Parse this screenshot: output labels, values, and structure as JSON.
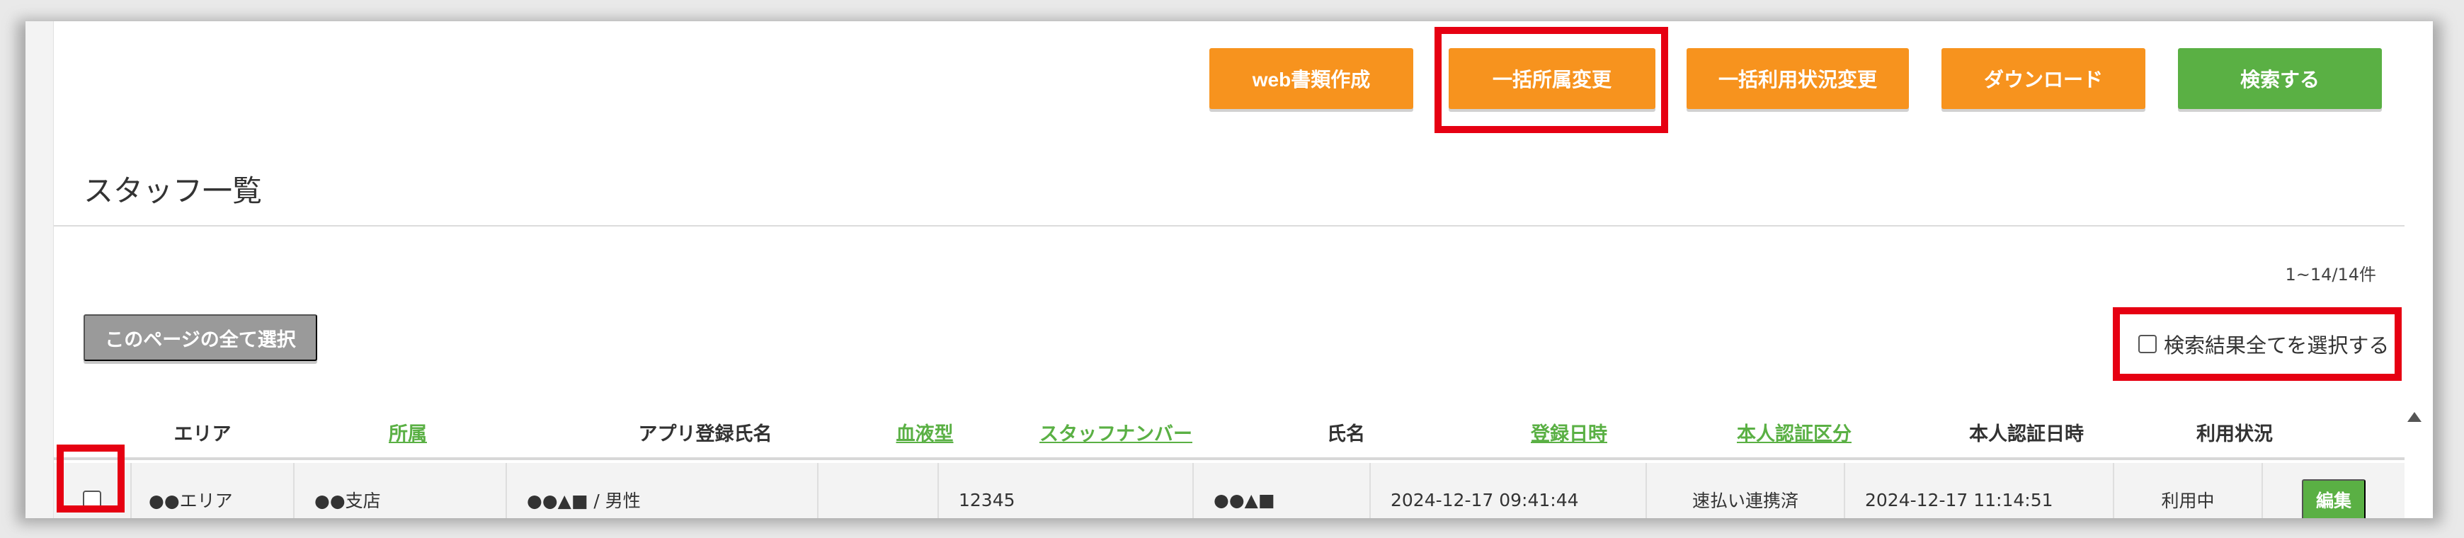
{
  "toolbar": {
    "web_docs": "web書類作成",
    "bulk_affiliation": "一括所属変更",
    "bulk_usage": "一括利用状況変更",
    "download": "ダウンロード",
    "search": "検索する"
  },
  "page_title": "スタッフ一覧",
  "result_count": "1~14/14件",
  "select_page_label": "このページの全て選択",
  "select_all_results_label": "検索結果全てを選択する",
  "table": {
    "headers": [
      "エリア",
      "所属",
      "アプリ登録氏名",
      "血液型",
      "スタッフナンバー",
      "氏名",
      "登録日時",
      "本人認証区分",
      "本人認証日時",
      "利用状況"
    ],
    "rows": [
      {
        "area": "●●エリア",
        "affiliation": "●●支店",
        "app_name": "●●▲■ / 男性",
        "blood_type": "",
        "staff_number": "12345",
        "name": "●●▲■",
        "registered_at": "2024-12-17 09:41:44",
        "verification_type": "速払い連携済",
        "verified_at": "2024-12-17 11:14:51",
        "usage_status": "利用中",
        "edit_label": "編集"
      }
    ]
  },
  "colors": {
    "orange": "#f7931e",
    "green": "#5ab044",
    "highlight": "#e60012"
  }
}
